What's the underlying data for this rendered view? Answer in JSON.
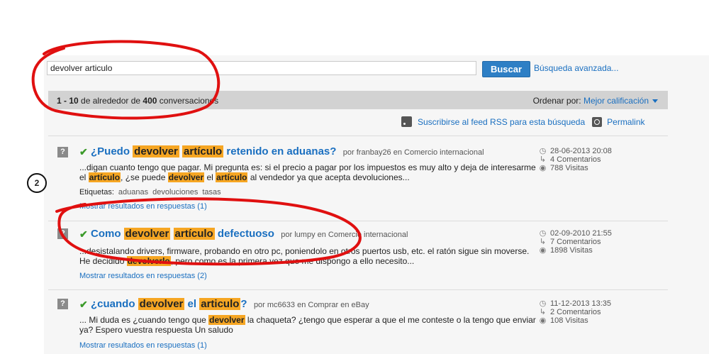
{
  "search": {
    "value": "devolver articulo",
    "button_label": "Buscar",
    "advanced_link": "Búsqueda avanzada..."
  },
  "results": {
    "range": "1 - 10",
    "of_text": " de alrededor de ",
    "total": "400",
    "suffix": " conversaciones",
    "sort_label": "Ordenar por:",
    "sort_value": "Mejor calificación"
  },
  "feed": {
    "rss_label": "Suscribirse al feed RSS para esta búsqueda",
    "permalink_label": "Permalink"
  },
  "items": [
    {
      "title_pre": "¿Puedo",
      "title_hl1": "devolver",
      "title_hl2": "artículo",
      "title_post": "retenido en aduanas?",
      "meta": "por franbay26 en Comercio internacional",
      "snippet_a": "...digan cuanto tengo que pagar. Mi pregunta es: si el precio a pagar por los impuestos es muy alto y deja de interesarme el",
      "snippet_hl1": "artículo",
      "snippet_b": ", ¿se puede",
      "snippet_hl2": "devolver",
      "snippet_c": "el",
      "snippet_hl3": "artículo",
      "snippet_d": "al vendedor ya que acepta devoluciones...",
      "tags_label": "Etiquetas:",
      "tags": [
        "aduanas",
        "devoluciones",
        "tasas"
      ],
      "more": "Mostrar resultados en respuestas (1)",
      "date": "28-06-2013 20:08",
      "comments": "4 Comentarios",
      "views": "788 Visitas"
    },
    {
      "title_pre": "Como",
      "title_hl1": "devolver",
      "title_hl2": "artículo",
      "title_post": "defectuoso",
      "meta": "por lumpy en Comercio internacional",
      "snippet_a": "...desistalando drivers, firmware, probando en otro pc, poniendolo en otros puertos usb, etc. el ratón sigue sin moverse. He decidido",
      "snippet_hl1": "devolverlo",
      "snippet_b": ", pero como es la primera vez que me dispongo a ello necesito...",
      "more": "Mostrar resultados en respuestas (2)",
      "date": "02-09-2010 21:55",
      "comments": "7 Comentarios",
      "views": "1898 Visitas"
    },
    {
      "title_pre": "¿cuando",
      "title_hl1": "devolver",
      "title_mid": "el",
      "title_hl2": "articulo",
      "title_post": "?",
      "meta": "por mc6633 en Comprar en eBay",
      "snippet_a": "... Mi duda es ¿cuando tengo que",
      "snippet_hl1": "devolver",
      "snippet_b": "la chaqueta? ¿tengo que esperar a que el me conteste o la tengo que enviar ya? Espero vuestra respuesta Un saludo",
      "more": "Mostrar resultados en respuestas (1)",
      "date": "11-12-2013 13:35",
      "comments": "2 Comentarios",
      "views": "108 Visitas"
    }
  ],
  "annotation": {
    "badge_number": "2",
    "ink_color": "#e01010"
  }
}
